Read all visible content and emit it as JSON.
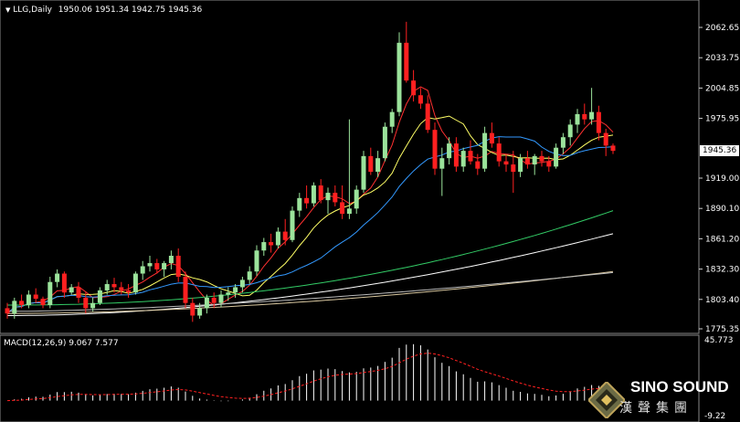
{
  "header": {
    "arrow": "▼",
    "symbol": "LLG,Daily",
    "ohlc": "1950.06 1951.34 1942.75 1945.36"
  },
  "price_axis": {
    "ticks": [
      "2062.65",
      "2033.75",
      "2004.85",
      "1975.95",
      "1945.36",
      "1919.00",
      "1890.10",
      "1861.20",
      "1832.30",
      "1803.40",
      "1775.35"
    ],
    "current": "1945.36"
  },
  "macd": {
    "label": "MACD(12,26,9) 9.067 7.577",
    "ticks": [
      "45.773",
      "-9.22"
    ]
  },
  "logo": {
    "name": "SINO SOUND",
    "sub": "漢聲集團"
  },
  "colors": {
    "up": "#9be39b",
    "down": "#ff2020",
    "ma5": "#ff3030",
    "ma10": "#ffff66",
    "ma20": "#3399ff",
    "ma60": "#33cc66",
    "ma120": "#ffffff",
    "ma200": "#d9c8a0"
  },
  "chart_data": {
    "type": "candlestick",
    "ylim": [
      1775.35,
      2062.65
    ],
    "candles": [
      [
        1795,
        1800,
        1785,
        1790
      ],
      [
        1790,
        1805,
        1785,
        1802
      ],
      [
        1802,
        1808,
        1795,
        1798
      ],
      [
        1798,
        1812,
        1795,
        1808
      ],
      [
        1808,
        1814,
        1800,
        1804
      ],
      [
        1804,
        1806,
        1795,
        1798
      ],
      [
        1798,
        1825,
        1795,
        1820
      ],
      [
        1820,
        1832,
        1815,
        1828
      ],
      [
        1828,
        1830,
        1805,
        1810
      ],
      [
        1810,
        1818,
        1808,
        1815
      ],
      [
        1815,
        1820,
        1800,
        1805
      ],
      [
        1805,
        1810,
        1790,
        1795
      ],
      [
        1795,
        1805,
        1792,
        1800
      ],
      [
        1800,
        1815,
        1798,
        1812
      ],
      [
        1812,
        1822,
        1808,
        1818
      ],
      [
        1818,
        1824,
        1810,
        1815
      ],
      [
        1815,
        1820,
        1808,
        1812
      ],
      [
        1812,
        1818,
        1805,
        1810
      ],
      [
        1810,
        1830,
        1808,
        1828
      ],
      [
        1828,
        1840,
        1822,
        1835
      ],
      [
        1835,
        1845,
        1830,
        1838
      ],
      [
        1838,
        1842,
        1828,
        1832
      ],
      [
        1832,
        1840,
        1825,
        1838
      ],
      [
        1838,
        1850,
        1832,
        1845
      ],
      [
        1845,
        1852,
        1820,
        1825
      ],
      [
        1825,
        1830,
        1795,
        1800
      ],
      [
        1800,
        1805,
        1782,
        1788
      ],
      [
        1788,
        1800,
        1785,
        1795
      ],
      [
        1795,
        1808,
        1790,
        1805
      ],
      [
        1805,
        1810,
        1795,
        1800
      ],
      [
        1800,
        1812,
        1796,
        1808
      ],
      [
        1808,
        1815,
        1802,
        1810
      ],
      [
        1810,
        1818,
        1805,
        1815
      ],
      [
        1815,
        1825,
        1810,
        1822
      ],
      [
        1822,
        1835,
        1818,
        1830
      ],
      [
        1830,
        1855,
        1826,
        1850
      ],
      [
        1850,
        1862,
        1845,
        1858
      ],
      [
        1858,
        1866,
        1848,
        1855
      ],
      [
        1855,
        1872,
        1852,
        1868
      ],
      [
        1868,
        1880,
        1855,
        1860
      ],
      [
        1860,
        1892,
        1858,
        1888
      ],
      [
        1888,
        1905,
        1882,
        1900
      ],
      [
        1900,
        1912,
        1890,
        1895
      ],
      [
        1895,
        1915,
        1892,
        1912
      ],
      [
        1912,
        1918,
        1895,
        1898
      ],
      [
        1898,
        1910,
        1885,
        1905
      ],
      [
        1905,
        1912,
        1892,
        1896
      ],
      [
        1896,
        1912,
        1880,
        1885
      ],
      [
        1885,
        1975,
        1880,
        1890
      ],
      [
        1890,
        1912,
        1885,
        1908
      ],
      [
        1908,
        1945,
        1905,
        1940
      ],
      [
        1940,
        1948,
        1922,
        1925
      ],
      [
        1925,
        1945,
        1920,
        1938
      ],
      [
        1938,
        1972,
        1935,
        1968
      ],
      [
        1968,
        1985,
        1962,
        1982
      ],
      [
        1982,
        2058,
        1978,
        2048
      ],
      [
        2048,
        2068,
        2010,
        2012
      ],
      [
        2012,
        2022,
        1992,
        1998
      ],
      [
        1998,
        2005,
        1985,
        1990
      ],
      [
        1990,
        1998,
        1962,
        1965
      ],
      [
        1965,
        1972,
        1922,
        1928
      ],
      [
        1928,
        1948,
        1902,
        1938
      ],
      [
        1938,
        1958,
        1932,
        1952
      ],
      [
        1952,
        1958,
        1925,
        1930
      ],
      [
        1930,
        1948,
        1925,
        1945
      ],
      [
        1945,
        1955,
        1932,
        1935
      ],
      [
        1935,
        1942,
        1922,
        1928
      ],
      [
        1928,
        1968,
        1925,
        1962
      ],
      [
        1962,
        1972,
        1948,
        1952
      ],
      [
        1952,
        1958,
        1930,
        1935
      ],
      [
        1935,
        1942,
        1925,
        1932
      ],
      [
        1932,
        1945,
        1905,
        1925
      ],
      [
        1925,
        1942,
        1920,
        1938
      ],
      [
        1938,
        1945,
        1928,
        1932
      ],
      [
        1932,
        1942,
        1922,
        1940
      ],
      [
        1940,
        1945,
        1930,
        1935
      ],
      [
        1935,
        1940,
        1925,
        1930
      ],
      [
        1930,
        1952,
        1928,
        1948
      ],
      [
        1948,
        1962,
        1942,
        1958
      ],
      [
        1958,
        1975,
        1950,
        1970
      ],
      [
        1970,
        1985,
        1962,
        1980
      ],
      [
        1980,
        1990,
        1970,
        1975
      ],
      [
        1975,
        2005,
        1970,
        1982
      ],
      [
        1982,
        1988,
        1955,
        1962
      ],
      [
        1962,
        1966,
        1940,
        1950
      ],
      [
        1950,
        1952,
        1942,
        1945
      ]
    ]
  }
}
